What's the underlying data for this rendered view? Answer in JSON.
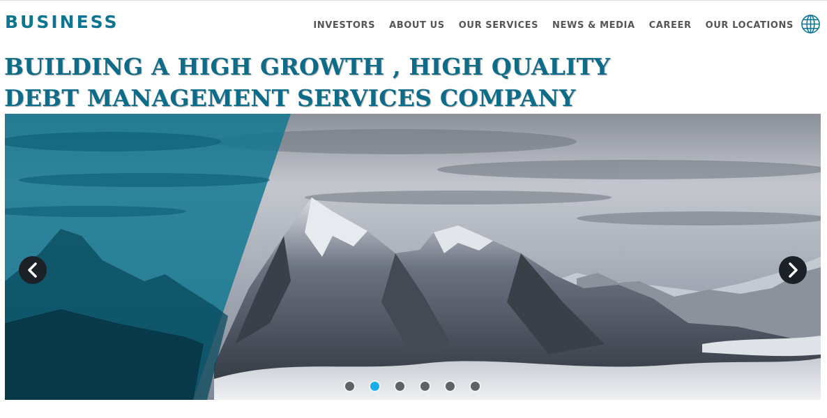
{
  "brand": {
    "name": "BUSINESS",
    "color": "#0f7490"
  },
  "nav": {
    "items": [
      "INVESTORS",
      "ABOUT US",
      "OUR SERVICES",
      "NEWS & MEDIA",
      "CAREER",
      "OUR LOCATIONS"
    ],
    "language_icon": "globe-icon"
  },
  "hero": {
    "headline_line1": "BUILDING A HIGH GROWTH , HIGH QUALITY",
    "headline_line2": "DEBT MANAGEMENT SERVICES COMPANY"
  },
  "slider": {
    "prev_icon": "chevron-left-icon",
    "next_icon": "chevron-right-icon",
    "slide_count": 6,
    "active_slide": 2,
    "accent_color": "#18aeea",
    "overlay_color": "#0e7690"
  }
}
